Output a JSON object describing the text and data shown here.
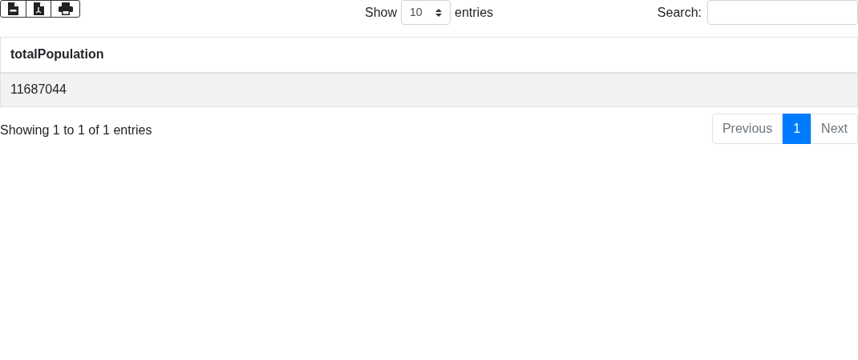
{
  "export_buttons": [
    {
      "kind": "csv"
    },
    {
      "kind": "pdf"
    },
    {
      "kind": "print"
    }
  ],
  "length": {
    "label_before": "Show",
    "value": "10",
    "label_after": "entries"
  },
  "search": {
    "label": "Search:"
  },
  "table": {
    "columns": [
      "totalPopulation"
    ],
    "rows": [
      [
        "11687044"
      ]
    ]
  },
  "info": "Showing 1 to 1 of 1 entries",
  "pagination": [
    {
      "label": "Previous",
      "selected": false
    },
    {
      "label": "1",
      "selected": true
    },
    {
      "label": "Next",
      "selected": false
    }
  ]
}
